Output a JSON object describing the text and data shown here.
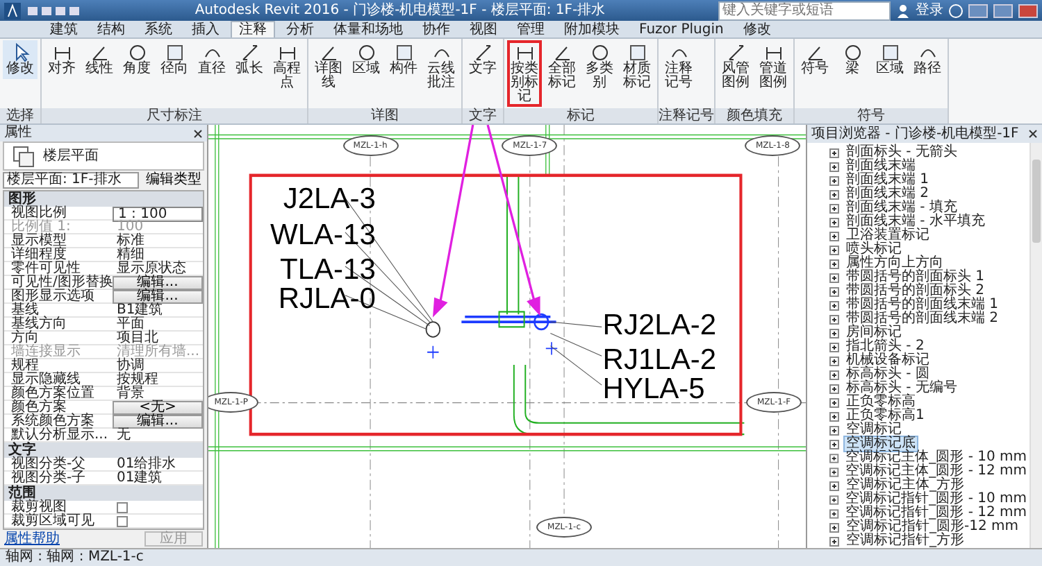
{
  "title_bar": {
    "title": "Autodesk Revit 2016 - 门诊楼-机电模型-1F - 楼层平面: 1F-排水",
    "search_placeholder": "键入关键字或短语",
    "sign_in": "登录"
  },
  "ribbon": {
    "tabs": [
      {
        "label": "建筑",
        "selected": false
      },
      {
        "label": "结构",
        "selected": false
      },
      {
        "label": "系统",
        "selected": false
      },
      {
        "label": "插入",
        "selected": false
      },
      {
        "label": "注释",
        "selected": true
      },
      {
        "label": "分析",
        "selected": false
      },
      {
        "label": "体量和场地",
        "selected": false
      },
      {
        "label": "协作",
        "selected": false
      },
      {
        "label": "视图",
        "selected": false
      },
      {
        "label": "管理",
        "selected": false
      },
      {
        "label": "附加模块",
        "selected": false
      },
      {
        "label": "Fuzor Plugin",
        "selected": false
      },
      {
        "label": "修改",
        "selected": false
      }
    ],
    "panels": [
      {
        "label": "选择",
        "buttons": [
          {
            "label": "修改",
            "annotated": false
          }
        ]
      },
      {
        "label": "尺寸标注",
        "buttons": [
          {
            "label": "对齐",
            "annotated": false
          },
          {
            "label": "线性",
            "annotated": false
          },
          {
            "label": "角度",
            "annotated": false
          },
          {
            "label": "径向",
            "annotated": false
          },
          {
            "label": "直径",
            "annotated": false
          },
          {
            "label": "弧长",
            "annotated": false
          },
          {
            "label": "高程点",
            "annotated": false
          }
        ]
      },
      {
        "label": "详图",
        "buttons": [
          {
            "label": "详图线",
            "annotated": false
          },
          {
            "label": "区域",
            "annotated": false
          },
          {
            "label": "构件",
            "annotated": false
          },
          {
            "label": "云线批注",
            "annotated": false
          }
        ]
      },
      {
        "label": "文字",
        "buttons": [
          {
            "label": "文字",
            "annotated": false
          }
        ]
      },
      {
        "label": "标记",
        "buttons": [
          {
            "label": "按类别标记",
            "annotated": true
          },
          {
            "label": "全部标记",
            "annotated": false
          },
          {
            "label": "多类别",
            "annotated": false
          },
          {
            "label": "材质标记",
            "annotated": false
          }
        ]
      },
      {
        "label": "注释记号",
        "buttons": [
          {
            "label": "注释记号",
            "annotated": false
          }
        ]
      },
      {
        "label": "颜色填充",
        "buttons": [
          {
            "label": "风管图例",
            "annotated": false
          },
          {
            "label": "管道图例",
            "annotated": false
          }
        ]
      },
      {
        "label": "符号",
        "buttons": [
          {
            "label": "符号",
            "annotated": false
          },
          {
            "label": "梁",
            "annotated": false
          },
          {
            "label": "区域",
            "annotated": false
          },
          {
            "label": "路径",
            "annotated": false
          }
        ]
      }
    ]
  },
  "properties": {
    "title": "属性",
    "type_name": "楼层平面",
    "selector": "楼层平面: 1F-排水",
    "edit_type": "编辑类型",
    "rows": [
      {
        "kind": "section",
        "label": "图形"
      },
      {
        "kind": "input",
        "label": "视图比例",
        "value": "1 : 100"
      },
      {
        "kind": "disabled",
        "label": "比例值 1:",
        "value": "100"
      },
      {
        "kind": "text",
        "label": "显示模型",
        "value": "标准"
      },
      {
        "kind": "text",
        "label": "详细程度",
        "value": "精细"
      },
      {
        "kind": "text",
        "label": "零件可见性",
        "value": "显示原状态"
      },
      {
        "kind": "button",
        "label": "可见性/图形替换",
        "value": "编辑..."
      },
      {
        "kind": "button",
        "label": "图形显示选项",
        "value": "编辑..."
      },
      {
        "kind": "text",
        "label": "基线",
        "value": "B1建筑"
      },
      {
        "kind": "text",
        "label": "基线方向",
        "value": "平面"
      },
      {
        "kind": "text",
        "label": "方向",
        "value": "项目北"
      },
      {
        "kind": "disabled",
        "label": "墙连接显示",
        "value": "清理所有墙..."
      },
      {
        "kind": "text",
        "label": "规程",
        "value": "协调"
      },
      {
        "kind": "text",
        "label": "显示隐藏线",
        "value": "按规程"
      },
      {
        "kind": "text",
        "label": "颜色方案位置",
        "value": "背景"
      },
      {
        "kind": "button",
        "label": "颜色方案",
        "value": "<无>"
      },
      {
        "kind": "button",
        "label": "系统颜色方案",
        "value": "编辑..."
      },
      {
        "kind": "text",
        "label": "默认分析显示...",
        "value": "无"
      },
      {
        "kind": "section",
        "label": "文字"
      },
      {
        "kind": "text",
        "label": "视图分类-父",
        "value": "01给排水"
      },
      {
        "kind": "text",
        "label": "视图分类-子",
        "value": "01建筑"
      },
      {
        "kind": "section",
        "label": "范围"
      },
      {
        "kind": "checkbox",
        "label": "裁剪视图",
        "checked": false
      },
      {
        "kind": "checkbox",
        "label": "裁剪区域可见",
        "checked": false
      }
    ],
    "help": "属性帮助",
    "apply": "应用"
  },
  "canvas": {
    "grid_labels": [
      "MZL-1-h",
      "MZL-1-7",
      "MZL-1-8",
      "MZL-1-P",
      "MZL-1-F",
      "MZL-1-c"
    ],
    "left_tags": [
      "J2LA-3",
      "WLA-13",
      "TLA-13",
      "RJLA-0"
    ],
    "right_tags": [
      "RJ2LA-2",
      "RJ1LA-2",
      "HYLA-5"
    ]
  },
  "project_browser": {
    "title": "项目浏览器 - 门诊楼-机电模型-1F",
    "items": [
      {
        "label": "剖面标头 - 无箭头",
        "selected": false
      },
      {
        "label": "剖面线末端",
        "selected": false
      },
      {
        "label": "剖面线末端 1",
        "selected": false
      },
      {
        "label": "剖面线末端 2",
        "selected": false
      },
      {
        "label": "剖面线末端 - 填充",
        "selected": false
      },
      {
        "label": "剖面线末端 - 水平填充",
        "selected": false
      },
      {
        "label": "卫浴装置标记",
        "selected": false
      },
      {
        "label": "喷头标记",
        "selected": false
      },
      {
        "label": "属性方向上方向",
        "selected": false
      },
      {
        "label": "带圆括号的剖面标头 1",
        "selected": false
      },
      {
        "label": "带圆括号的剖面标头 2",
        "selected": false
      },
      {
        "label": "带圆括号的剖面线末端 1",
        "selected": false
      },
      {
        "label": "带圆括号的剖面线末端 2",
        "selected": false
      },
      {
        "label": "房间标记",
        "selected": false
      },
      {
        "label": "指北箭头 - 2",
        "selected": false
      },
      {
        "label": "机械设备标记",
        "selected": false
      },
      {
        "label": "标高标头 - 圆",
        "selected": false
      },
      {
        "label": "标高标头 - 无编号",
        "selected": false
      },
      {
        "label": "正负零标高",
        "selected": false
      },
      {
        "label": "正负零标高1",
        "selected": false
      },
      {
        "label": "空调标记",
        "selected": false
      },
      {
        "label": "空调标记底",
        "selected": true
      },
      {
        "label": "空调标记主体_圆形 - 10 mm",
        "selected": false
      },
      {
        "label": "空调标记主体_圆形 - 12 mm",
        "selected": false
      },
      {
        "label": "空调标记主体_方形",
        "selected": false
      },
      {
        "label": "空调标记指针_圆形 - 10 mm",
        "selected": false
      },
      {
        "label": "空调标记指针_圆形 - 12 mm",
        "selected": false
      },
      {
        "label": "空调标记指针_圆形-12 mm",
        "selected": false
      },
      {
        "label": "空调标记指针_方形",
        "selected": false
      }
    ]
  },
  "status_bar": {
    "text": "轴网 : 轴网 : MZL-1-c"
  }
}
